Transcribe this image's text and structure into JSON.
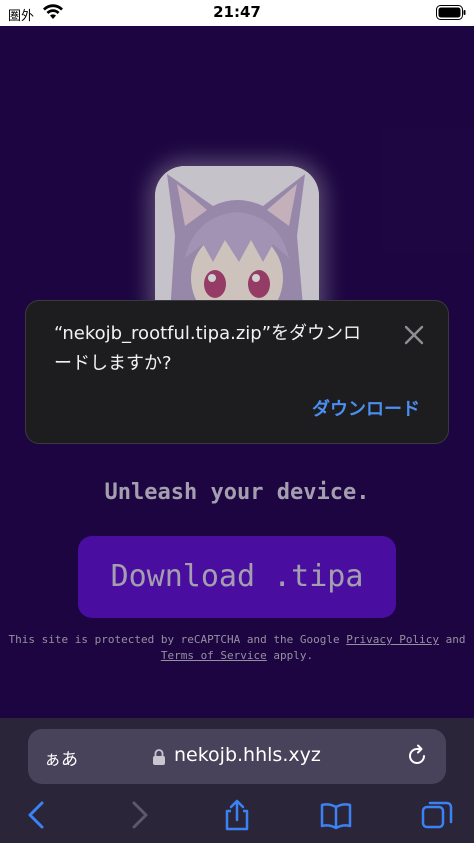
{
  "status_bar": {
    "carrier": "圏外",
    "time": "21:47"
  },
  "page": {
    "tagline": "Unleash your device.",
    "download_label": "Download .tipa",
    "recaptcha_prefix": "This site is protected by reCAPTCHA and the Google",
    "privacy_link": "Privacy Policy",
    "and_text": "and",
    "terms_link": "Terms of Service",
    "apply_text": "apply."
  },
  "dialog": {
    "message_line1": "“nekojb_rootful.tipa.zip”をダウンロ",
    "message_line2": "ードしますか?",
    "action_label": "ダウンロード"
  },
  "safari": {
    "aa_label": "ぁあ",
    "url": "nekojb.hhls.xyz"
  },
  "colors": {
    "background": "#23074f",
    "button": "#5a10c4",
    "accent_link": "#4b8ff0"
  },
  "icons": [
    "wifi-icon",
    "battery-icon",
    "close-icon",
    "lock-icon",
    "reload-icon",
    "back-icon",
    "forward-icon",
    "share-icon",
    "bookmarks-icon",
    "tabs-icon"
  ]
}
